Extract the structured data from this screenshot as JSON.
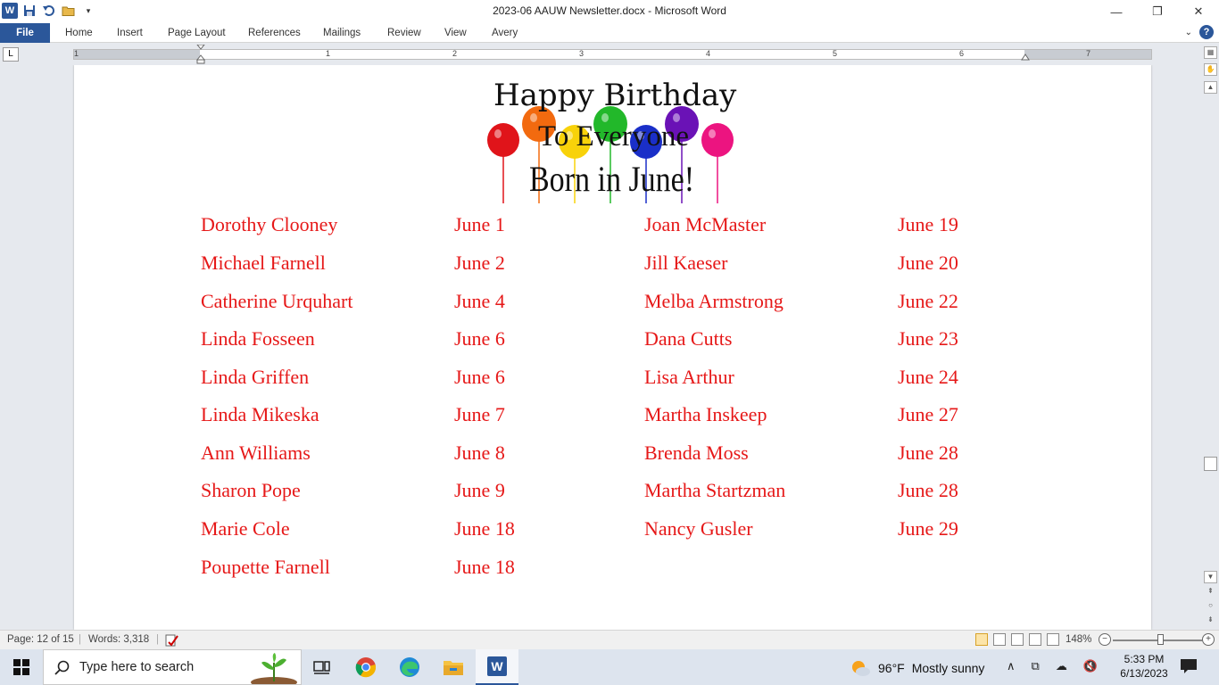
{
  "window": {
    "title": "2023-06 AAUW Newsletter.docx  -  Microsoft Word",
    "minimize": "—",
    "restore": "❐",
    "close": "✕"
  },
  "ribbon": {
    "tabs": [
      "File",
      "Home",
      "Insert",
      "Page Layout",
      "References",
      "Mailings",
      "Review",
      "View",
      "Avery"
    ],
    "help": "?"
  },
  "ruler": {
    "numbers": [
      "1",
      "1",
      "2",
      "3",
      "4",
      "5",
      "6",
      "7"
    ]
  },
  "document": {
    "graphic": {
      "line1": "Happy Birthday",
      "line2": "To Everyone",
      "line3": "Born in June!",
      "balloon_colors": [
        "#e0141a",
        "#f26a0f",
        "#f8d20a",
        "#22b82a",
        "#1a2fc8",
        "#6a12b6",
        "#ec1480"
      ]
    },
    "birthdays": [
      {
        "name1": "Dorothy Clooney",
        "date1": "June 1",
        "name2": "Joan McMaster",
        "date2": "June 19"
      },
      {
        "name1": "Michael Farnell",
        "date1": "June 2",
        "name2": "Jill Kaeser",
        "date2": "June 20"
      },
      {
        "name1": "Catherine Urquhart",
        "date1": "June 4",
        "name2": "Melba Armstrong",
        "date2": "June 22"
      },
      {
        "name1": "Linda Fosseen",
        "date1": "June 6",
        "name2": "Dana Cutts",
        "date2": "June 23"
      },
      {
        "name1": "Linda Griffen",
        "date1": "June 6",
        "name2": "Lisa Arthur",
        "date2": "June 24"
      },
      {
        "name1": "Linda Mikeska",
        "date1": "June 7",
        "name2": "Martha Inskeep",
        "date2": "June 27"
      },
      {
        "name1": "Ann Williams",
        "date1": "June 8",
        "name2": "Brenda Moss",
        "date2": "June 28"
      },
      {
        "name1": "Sharon Pope",
        "date1": "June 9",
        "name2": "Martha Startzman",
        "date2": "June 28"
      },
      {
        "name1": "Marie Cole",
        "date1": "June 18",
        "name2": "Nancy Gusler",
        "date2": "June 29"
      },
      {
        "name1": "Poupette Farnell",
        "date1": "June 18",
        "name2": "",
        "date2": ""
      }
    ],
    "text_color": "#e61818"
  },
  "status": {
    "page": "Page: 12 of 15",
    "words": "Words: 3,318",
    "zoom": "148%",
    "zoom_minus": "−",
    "zoom_plus": "+"
  },
  "taskbar": {
    "search_placeholder": "Type here to search",
    "weather_temp": "96°F",
    "weather_text": "Mostly sunny",
    "time": "5:33 PM",
    "date": "6/13/2023"
  }
}
